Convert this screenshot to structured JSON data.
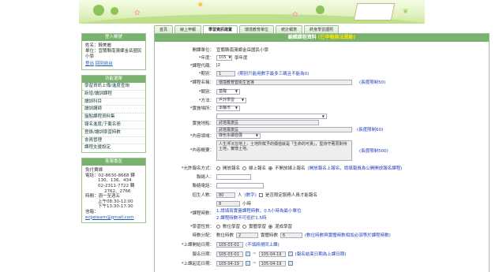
{
  "tabs": [
    "首頁",
    "線上申報",
    "學習資訊建置",
    "環境教育單位",
    "統計報表",
    "終身學習護照"
  ],
  "login": {
    "header": "登入帳號",
    "name_label": "姓名：",
    "name": "韓美麗",
    "unit_label": "單位：",
    "unit": "宜蘭縣南澳鄉金岳國民小學",
    "logout": "登出",
    "switch": "回到前台"
  },
  "menu": {
    "header": "功能選單",
    "items": [
      "學習資訊上傳/進度查詢",
      "新增/讀訓課程",
      "讀訓科目",
      "讀訓講師",
      "盤點課程資料集",
      "報名進度/下載名冊",
      "登錄/讀訓學習時數",
      "會員管理",
      "課程支援設定"
    ]
  },
  "support": {
    "header": "客服專區",
    "title": "免付費線",
    "lines": [
      "電話：02-8630-8668 轉",
      "130、136、434",
      "02-2311-7722 轉",
      "2762、2766",
      "時間：週一至週五",
      "上午08:30-12:00",
      "下午13:30-17:30"
    ],
    "email_label": "信箱：",
    "email": "ecpelearn@gmail.com"
  },
  "main": {
    "title": "編輯課程資料",
    "warn": "(已申報無法異動)",
    "rows": {
      "unit": {
        "label": "開課單位：",
        "value": "宜蘭縣南澳鄉金岳國民小學"
      },
      "year": {
        "label": "*年度：",
        "value": "105",
        "suffix": "學年度"
      },
      "code": {
        "label": "*課程代碼：",
        "value": "J2"
      },
      "period": {
        "label": "*期別：",
        "value": "1",
        "note": "(期別只能用數字最多三碼且不能為0)"
      },
      "name": {
        "label": "*課程名稱：",
        "value": "環境教育暨衛生宣導",
        "limit": "(長度限制50)"
      },
      "category": {
        "label": "*類別：",
        "value": "基礎"
      },
      "method": {
        "label": "*方法：",
        "value": "戶外學習"
      },
      "place_type": {
        "label": "*實施場所：",
        "value": "本縣市"
      },
      "place": {
        "label": "實施地點：",
        "select": "",
        "value": "武塔風景區",
        "value2": "武塔風景區",
        "limit": "(長度限制60)"
      },
      "domain": {
        "label": "*內容領域：",
        "value": "綠色永續發展"
      },
      "summary": {
        "label": "*內容概要：",
        "value": "人生浮沉在地上，土地所賦予的價值就是「生命的可貴」，堅持守著原對待土地，實懷土地。",
        "limit": "(長度限制500)"
      },
      "signup": {
        "label": "*允許報名方式：",
        "opts": [
          "開放報名",
          "線上報名",
          "不開放線上報名"
        ],
        "note": "(開放報名上報名，請填報員為公開開放報名課程)"
      },
      "contact": {
        "label": "聯絡人："
      },
      "phone": {
        "label": "聯絡電話："
      },
      "capacity": {
        "label": "招生人數：",
        "value": "80",
        "unit": "人",
        "hint": "(數字)",
        "check": "是否限定服務人員才能報名"
      },
      "hours": {
        "label": "*課程時數：",
        "value": "8",
        "unit": "小時",
        "note1": "1.請填寫實量課程時數，0.5小時為最小單位",
        "note2": "2.課程時數不可低於1.5時"
      },
      "form": {
        "label": "*學習性質：",
        "opts": [
          "數位學習",
          "實體學習",
          "混成學習"
        ]
      },
      "alloc": {
        "label": "時數分配：",
        "d_label": "數位時數",
        "d_value": "2",
        "p_label": "實體時數",
        "p_value": "6",
        "note": "(數位時數與實體時數相加必須等於課程時數)"
      },
      "start": {
        "label": "*上課開始日期：",
        "value": "105-03-01",
        "note": "(不填將視同上課)"
      },
      "reg": {
        "label": "報名日期：",
        "from": "105-03-01",
        "to": "105-04-19",
        "note": "(報名結束日期為上課日期)"
      },
      "end": {
        "label": "*上課起迄日期：",
        "from": "105-04-19",
        "to": "105-04-19"
      }
    }
  }
}
